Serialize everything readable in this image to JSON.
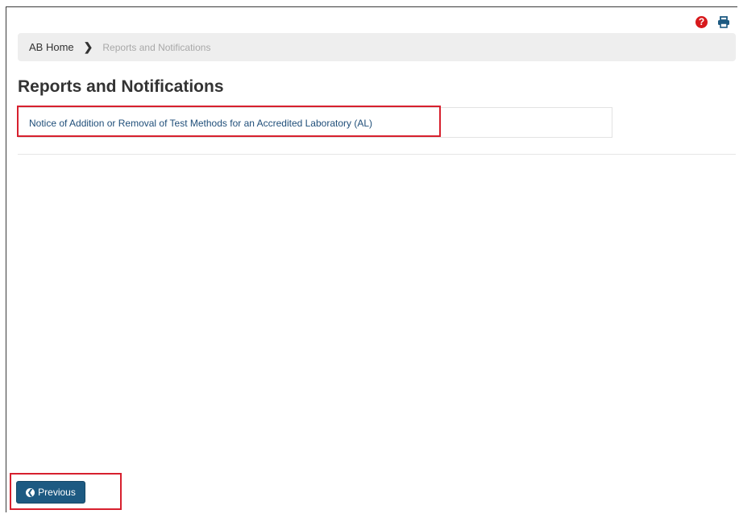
{
  "toolbar": {
    "help_icon": "question-circle-icon",
    "print_icon": "print-icon",
    "help_glyph": "?"
  },
  "breadcrumb": {
    "home": "AB Home",
    "current": "Reports and Notifications"
  },
  "page": {
    "title": "Reports and Notifications"
  },
  "reports": [
    {
      "label": "Notice of Addition or Removal of Test Methods for an Accredited Laboratory (AL)"
    }
  ],
  "footer": {
    "previous_label": "Previous"
  },
  "colors": {
    "accent": "#1d5a82",
    "highlight": "#d7202e",
    "help": "#d7191c"
  }
}
